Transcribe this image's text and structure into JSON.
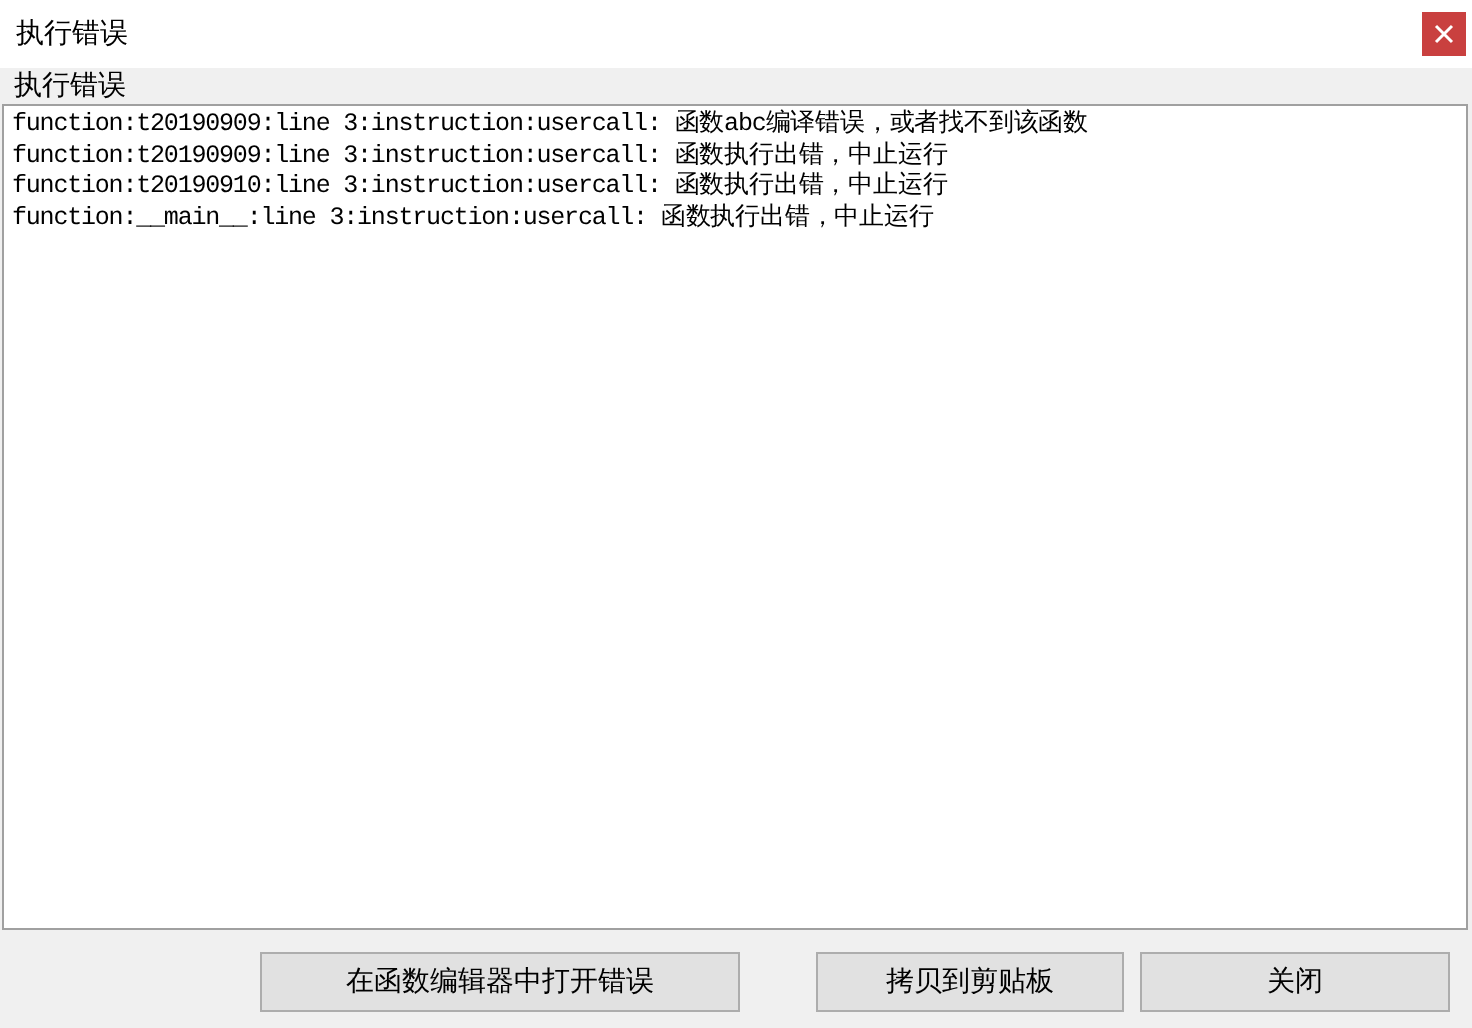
{
  "window": {
    "title": "执行错误"
  },
  "log_label": "执行错误",
  "log_lines": [
    "function:t20190909:line 3:instruction:usercall: 函数abc编译错误，或者找不到该函数",
    "function:t20190909:line 3:instruction:usercall: 函数执行出错，中止运行",
    "function:t20190910:line 3:instruction:usercall: 函数执行出错，中止运行",
    "function:__main__:line 3:instruction:usercall: 函数执行出错，中止运行"
  ],
  "buttons": [
    "在函数编辑器中打开错误",
    "拷贝到剪贴板",
    "关闭"
  ]
}
